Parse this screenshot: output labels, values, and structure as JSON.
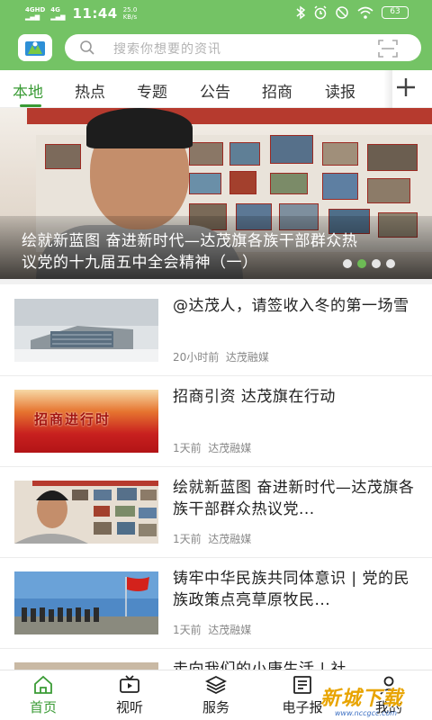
{
  "status_bar": {
    "network1": "4GHD",
    "network2": "4G",
    "time": "11:44",
    "speed_value": "25.0",
    "speed_unit": "KB/s",
    "battery": "63"
  },
  "search": {
    "placeholder": "搜索你想要的资讯"
  },
  "tabs": [
    {
      "label": "本地",
      "active": true
    },
    {
      "label": "热点"
    },
    {
      "label": "专题"
    },
    {
      "label": "公告"
    },
    {
      "label": "招商"
    },
    {
      "label": "读报"
    }
  ],
  "banner": {
    "caption": "绘就新蓝图  奋进新时代—达茂旗各族干部群众热议党的十九届五中全会精神（一）",
    "slides": 4,
    "active_slide": 2
  },
  "news": [
    {
      "title": "@达茂人，请签收入冬的第一场雪",
      "time": "20小时前",
      "source": "达茂融媒",
      "thumb_icon": "snowy-building-thumbnail"
    },
    {
      "title": "招商引资  达茂旗在行动",
      "time": "1天前",
      "source": "达茂融媒",
      "thumb_icon": "investment-banner-thumbnail",
      "thumb_text": "招商进行时"
    },
    {
      "title": "绘就新蓝图  奋进新时代—达茂旗各族干部群众热议党...",
      "time": "1天前",
      "source": "达茂融媒",
      "thumb_icon": "interview-thumbnail"
    },
    {
      "title": "铸牢中华民族共同体意识  |  党的民族政策点亮草原牧民...",
      "time": "1天前",
      "source": "达茂融媒",
      "thumb_icon": "flag-ceremony-thumbnail"
    },
    {
      "title": "走向我们的小康生活  |  社",
      "time": "",
      "source": "",
      "thumb_icon": "partial-thumbnail"
    }
  ],
  "bottom_nav": [
    {
      "label": "首页",
      "icon": "home-icon",
      "active": true
    },
    {
      "label": "视听",
      "icon": "tv-icon"
    },
    {
      "label": "服务",
      "icon": "layers-icon"
    },
    {
      "label": "电子报",
      "icon": "newspaper-icon"
    },
    {
      "label": "我的",
      "icon": "user-icon"
    }
  ],
  "watermark": {
    "text": "新城下载",
    "url": "www.nccgcc.com"
  },
  "colors": {
    "brand_green": "#74c365",
    "active_green": "#3a9b35"
  }
}
